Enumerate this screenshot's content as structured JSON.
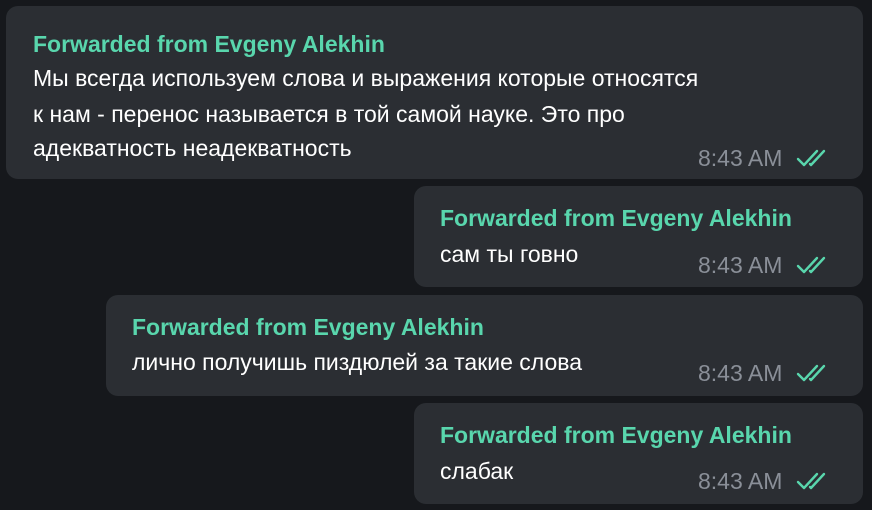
{
  "colors": {
    "background": "#16181c",
    "bubble": "#2b2e33",
    "forward_label": "#59d6ad",
    "text": "#ffffff",
    "time": "#8a8f98",
    "read_checks": "#59d6ad"
  },
  "messages": [
    {
      "forwarded": "Forwarded from Evgeny Alekhin",
      "lines": [
        "Мы всегда используем слова и выражения которые относятся",
        "к нам - перенос называется в той самой науке. Это про",
        "адекватность неадекватность"
      ],
      "time": "8:43 AM",
      "status_icon": "double-check-icon"
    },
    {
      "forwarded": "Forwarded from Evgeny Alekhin",
      "lines": [
        "сам ты говно"
      ],
      "time": "8:43 AM",
      "status_icon": "double-check-icon"
    },
    {
      "forwarded": "Forwarded from Evgeny Alekhin",
      "lines": [
        "лично получишь пиздюлей за такие слова"
      ],
      "time": "8:43 AM",
      "status_icon": "double-check-icon"
    },
    {
      "forwarded": "Forwarded from Evgeny Alekhin",
      "lines": [
        "слабак"
      ],
      "time": "8:43 AM",
      "status_icon": "double-check-icon"
    }
  ]
}
